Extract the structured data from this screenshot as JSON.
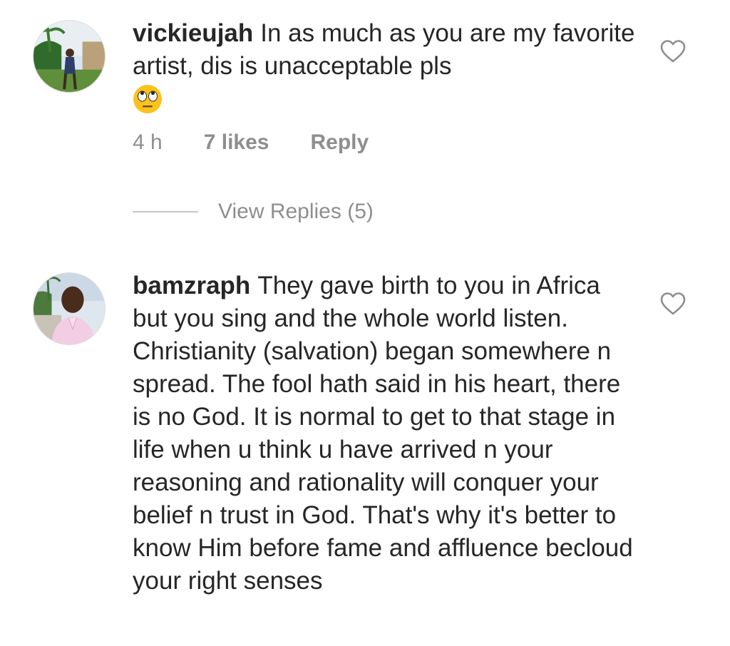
{
  "comments": [
    {
      "username": "vickieujah",
      "text": "In as much  as you are my favorite artist, dis is unacceptable pls",
      "emoji": "face-with-rolling-eyes",
      "time": "4 h",
      "likes": "7 likes",
      "reply_label": "Reply",
      "view_replies": "View Replies (5)"
    },
    {
      "username": "bamzraph",
      "text": "They gave birth to you in Africa but you sing and the whole world listen. Christianity (salvation) began somewhere n spread. The fool hath said in his heart, there is no God. It is normal to get to that stage in life when u think u have arrived n your reasoning and rationality will conquer your belief n trust in God. That's why it's better to know Him before fame and affluence becloud your right senses"
    }
  ],
  "icons": {
    "like": "heart-outline-icon"
  },
  "colors": {
    "text": "#262626",
    "secondary": "#8e8e8e",
    "divider": "#c7c7c7",
    "background": "#ffffff"
  }
}
